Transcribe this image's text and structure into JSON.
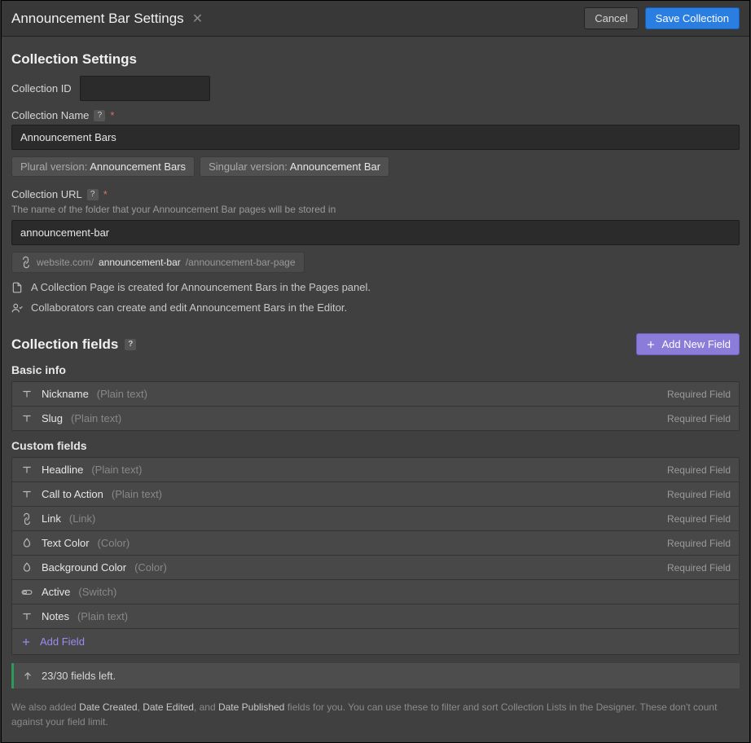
{
  "modal": {
    "title": "Announcement Bar Settings",
    "cancel": "Cancel",
    "save": "Save Collection"
  },
  "settings": {
    "heading": "Collection Settings",
    "id_label": "Collection ID",
    "id_value": "",
    "name_label": "Collection Name",
    "name_value": "Announcement Bars",
    "plural_prefix": "Plural version: ",
    "plural_value": "Announcement Bars",
    "singular_prefix": "Singular version: ",
    "singular_value": "Announcement Bar",
    "url_label": "Collection URL",
    "url_note": "The name of the folder that your Announcement Bar pages will be stored in",
    "url_value": "announcement-bar",
    "url_preview_prefix": "website.com/",
    "url_preview_slug": "announcement-bar",
    "url_preview_suffix": "/announcement-bar-page",
    "info1": "A Collection Page is created for Announcement Bars in the Pages panel.",
    "info2": "Collaborators can create and edit Announcement Bars in the Editor."
  },
  "fields": {
    "heading": "Collection fields",
    "add_new_field": "Add New Field",
    "basic_heading": "Basic info",
    "custom_heading": "Custom fields",
    "required_label": "Required Field",
    "add_field": "Add Field",
    "basic": [
      {
        "name": "Nickname",
        "type": "(Plain text)",
        "icon": "text",
        "required": true
      },
      {
        "name": "Slug",
        "type": "(Plain text)",
        "icon": "text",
        "required": true
      }
    ],
    "custom": [
      {
        "name": "Headline",
        "type": "(Plain text)",
        "icon": "text",
        "required": true
      },
      {
        "name": "Call to Action",
        "type": "(Plain text)",
        "icon": "text",
        "required": true
      },
      {
        "name": "Link",
        "type": "(Link)",
        "icon": "link",
        "required": true
      },
      {
        "name": "Text Color",
        "type": "(Color)",
        "icon": "color",
        "required": true
      },
      {
        "name": "Background Color",
        "type": "(Color)",
        "icon": "color",
        "required": true
      },
      {
        "name": "Active",
        "type": "(Switch)",
        "icon": "switch",
        "required": false
      },
      {
        "name": "Notes",
        "type": "(Plain text)",
        "icon": "text",
        "required": false
      }
    ],
    "counter": "23/30 fields left."
  },
  "footer": {
    "prefix": "We also added ",
    "d1": "Date Created",
    "sep1": ", ",
    "d2": "Date Edited",
    "sep2": ", and ",
    "d3": "Date Published",
    "suffix": " fields for you. You can use these to filter and sort Collection Lists in the Designer. These don't count against your field limit."
  }
}
